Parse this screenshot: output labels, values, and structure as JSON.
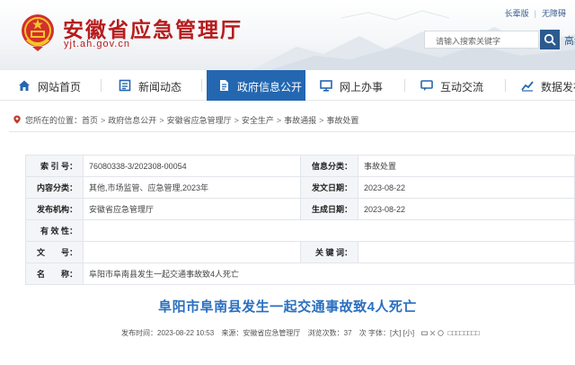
{
  "header": {
    "site_title": "安徽省应急管理厅",
    "site_domain": "yjt.ah.gov.cn",
    "top_links": [
      "长辈版",
      "无障碍"
    ],
    "search_placeholder": "请输入搜索关键字",
    "clipped_text": "高级"
  },
  "nav": {
    "items": [
      {
        "label": "网站首页",
        "icon": "home-icon"
      },
      {
        "label": "新闻动态",
        "icon": "news-icon"
      },
      {
        "label": "政府信息公开",
        "icon": "document-icon",
        "active": true
      },
      {
        "label": "网上办事",
        "icon": "monitor-icon"
      },
      {
        "label": "互动交流",
        "icon": "chat-icon"
      },
      {
        "label": "数据发布",
        "icon": "chart-icon"
      }
    ],
    "active_color": "#2467b1"
  },
  "breadcrumb": {
    "prefix": "您所在的位置：",
    "items": [
      "首页",
      "政府信息公开",
      "安徽省应急管理厅",
      "安全生产",
      "事故通报",
      "事故处置"
    ]
  },
  "info_table": {
    "rows": [
      {
        "k1": "索 引 号：",
        "v1": "76080338-3/202308-00054",
        "k2": "信息分类：",
        "v2": "事故处置"
      },
      {
        "k1": "内容分类：",
        "v1": "其他,市场监管、应急管理,2023年",
        "k2": "发文日期：",
        "v2": "2023-08-22"
      },
      {
        "k1": "发布机构：",
        "v1": "安徽省应急管理厅",
        "k2": "生成日期：",
        "v2": "2023-08-22"
      },
      {
        "k1": "有 效 性：",
        "v1": "",
        "k2": "",
        "v2": ""
      },
      {
        "k1": "文　　号：",
        "v1": "",
        "k2": "关 键 词：",
        "v2": ""
      },
      {
        "k1": "名　　称：",
        "v1": "阜阳市阜南县发生一起交通事故致4人死亡",
        "k2": "",
        "v2": ""
      }
    ]
  },
  "article": {
    "title": "阜阳市阜南县发生一起交通事故致4人死亡",
    "publish_time": "发布时间：2023-08-22 10:53",
    "source": "来源：安徽省应急管理厅",
    "views": "浏览次数：37",
    "font_size": "次 字体：[大] [小]",
    "share_glyphs": "□□□□□□□□"
  }
}
